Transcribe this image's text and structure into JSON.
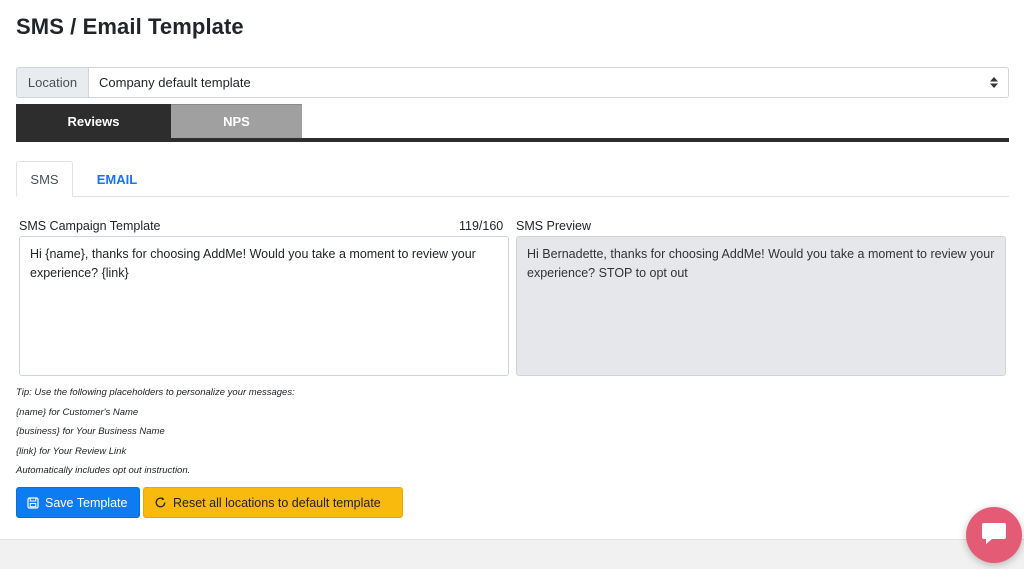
{
  "page": {
    "title": "SMS / Email Template"
  },
  "location": {
    "label": "Location",
    "selected": "Company default template"
  },
  "main_tabs": {
    "reviews": "Reviews",
    "nps": "NPS"
  },
  "sub_tabs": {
    "sms": "SMS",
    "email": "EMAIL"
  },
  "template": {
    "label": "SMS Campaign Template",
    "char_count": "119/160",
    "value": "Hi {name}, thanks for choosing AddMe! Would you take a moment to review your experience? {link}"
  },
  "preview": {
    "label": "SMS Preview",
    "text": "Hi Bernadette, thanks for choosing AddMe! Would you take a moment to review your experience?  STOP to opt out"
  },
  "tips": [
    "Tip: Use the following placeholders to personalize your messages:",
    "{name} for Customer's Name",
    "{business} for Your Business Name",
    "{link} for Your Review Link",
    "Automatically includes opt out instruction."
  ],
  "buttons": {
    "save": "Save Template",
    "reset": "Reset all locations to default template"
  },
  "colors": {
    "primary": "#0d7cf2",
    "warning": "#f9b90d",
    "dark_tab": "#2d2d2d",
    "inactive_tab": "#a0a0a0",
    "chat": "#e45b75",
    "link": "#1a73e8"
  },
  "icons": {
    "save": "save-icon",
    "reset": "refresh-icon",
    "select": "sort-icon",
    "chat": "chat-icon"
  }
}
